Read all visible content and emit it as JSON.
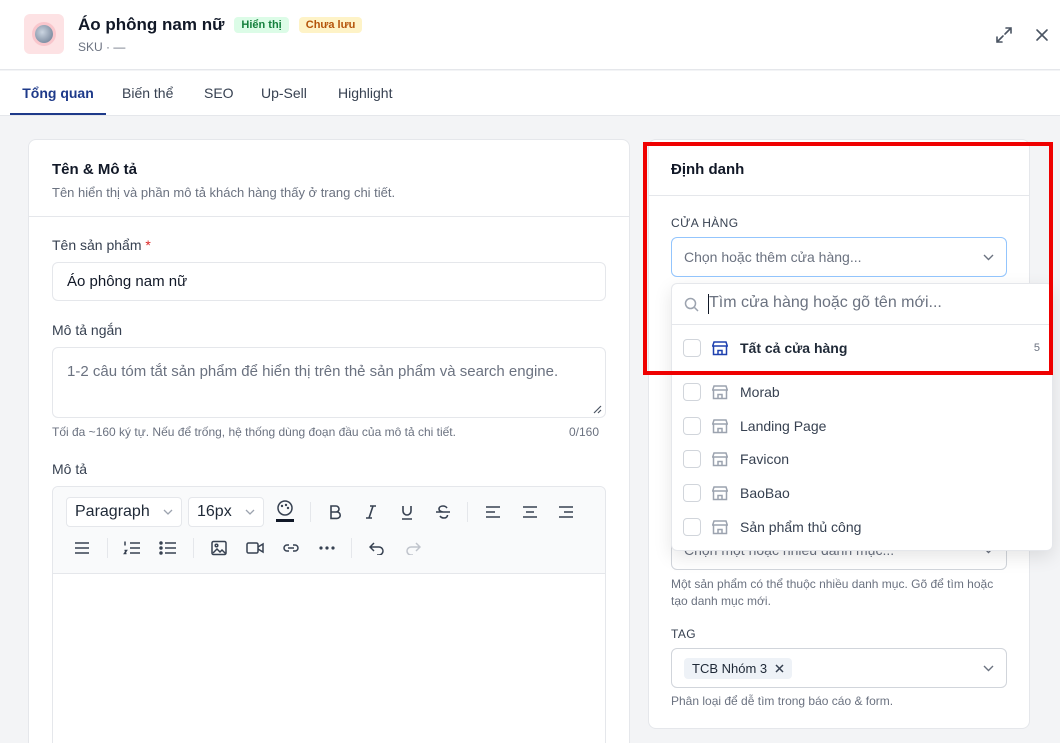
{
  "header": {
    "title": "Áo phông nam nữ",
    "status_visible": "Hiển thị",
    "status_unsaved": "Chưa lưu",
    "sku": "SKU · —",
    "expand_icon": "expand-icon",
    "close_icon": "close-icon"
  },
  "tabs": [
    {
      "label": "Tổng quan",
      "active": true
    },
    {
      "label": "Biến thể",
      "active": false
    },
    {
      "label": "SEO",
      "active": false
    },
    {
      "label": "Up-Sell",
      "active": false
    },
    {
      "label": "Highlight",
      "active": false
    }
  ],
  "name_desc": {
    "title": "Tên & Mô tả",
    "subtitle": "Tên hiển thị và phần mô tả khách hàng thấy ở trang chi tiết.",
    "product_name_label": "Tên sản phẩm",
    "required_mark": "*",
    "product_name_value": "Áo phông nam nữ",
    "short_desc_label": "Mô tả ngắn",
    "short_desc_placeholder": "1-2 câu tóm tắt sản phẩm để hiển thị trên thẻ sản phẩm và search engine.",
    "short_desc_hint": "Tối đa ~160 ký tự. Nếu để trống, hệ thống dùng đoạn đầu của mô tả chi tiết.",
    "short_desc_counter": "0/160",
    "desc_label": "Mô tả",
    "editor": {
      "block_format": "Paragraph",
      "font_size": "16px"
    }
  },
  "identity": {
    "title": "Định danh",
    "store_label": "CỬA HÀNG",
    "store_placeholder": "Chọn hoặc thêm cửa hàng...",
    "category_placeholder": "Chọn một hoặc nhiều danh mục...",
    "category_hint": "Một sản phẩm có thể thuộc nhiều danh mục. Gõ để tìm hoặc tạo danh mục mới.",
    "tag_label": "TAG",
    "tag_chip": "TCB Nhóm 3",
    "tag_hint": "Phân loại để dễ tìm trong báo cáo & form."
  },
  "store_dropdown": {
    "search_placeholder": "Tìm cửa hàng hoặc gõ tên mới...",
    "all_label": "Tất cả cửa hàng",
    "all_count": "5",
    "items": [
      "Morab",
      "Landing Page",
      "Favicon",
      "BaoBao",
      "Sản phẩm thủ công"
    ]
  },
  "colors": {
    "accent": "#1e3a8a",
    "highlight_border": "#ef0000",
    "visible_badge": "#15803d",
    "unsaved_badge": "#b45309"
  }
}
